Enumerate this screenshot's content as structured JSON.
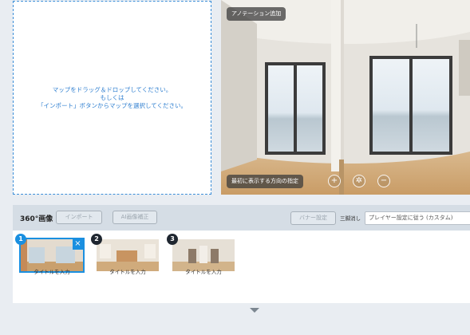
{
  "dropzone": {
    "line1": "マップをドラッグ＆ドロップしてください。",
    "line2": "もしくは",
    "line3": "「インポート」ボタンからマップを選択してください。"
  },
  "viewer": {
    "annotation_button": "アノテーション追加",
    "initial_direction_button": "最初に表示する方向の指定",
    "controls": [
      "add-icon",
      "settings-icon",
      "minus-icon"
    ]
  },
  "bar": {
    "title": "360°画像",
    "import_button": "インポート",
    "ai_button": "AI画像補正",
    "banner_button": "バナー設定",
    "tripod_label": "三脚消し",
    "player_select": "プレイヤー設定に従う (カスタム)"
  },
  "thumbnails": [
    {
      "number": "1",
      "label": "タイトルを入力",
      "selected": true
    },
    {
      "number": "2",
      "label": "タイトルを入力",
      "selected": false
    },
    {
      "number": "3",
      "label": "タイトルを入力",
      "selected": false
    }
  ],
  "colors": {
    "accent": "#1a8fe0",
    "dropzone_border": "#3b8ed8"
  }
}
